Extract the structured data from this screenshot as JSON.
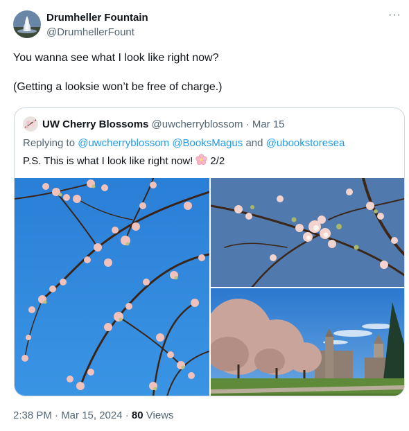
{
  "author": {
    "name": "Drumheller Fountain",
    "handle": "@DrumhellerFount",
    "avatar_icon": "fountain-avatar-icon"
  },
  "more_icon": "more-icon",
  "more_label": "···",
  "tweet": {
    "line1": "You wanna see what I look like right now?",
    "line2": "(Getting a looksie won’t be free of charge.)"
  },
  "quote": {
    "name": "UW Cherry Blossoms",
    "handle": "@uwcherryblossom",
    "date": "· Mar 15",
    "reply_prefix": "Replying to",
    "mention1": "@uwcherryblossom",
    "mention2": "@BooksMagus",
    "reply_and": "and",
    "mention3": "@ubookstoresea",
    "text_before": "P.S. This is what I look like right now!",
    "text_after": "2/2",
    "flower_icon": "cherry-blossom-emoji-icon"
  },
  "footer": {
    "time": "2:38 PM · Mar 15, 2024 ·",
    "view_count": "80",
    "views_label": "Views"
  },
  "colors": {
    "text": "#0f1419",
    "secondary": "#536471",
    "link": "#1d9bf0",
    "border": "#cfd9de",
    "sky": "#2f86d8"
  }
}
